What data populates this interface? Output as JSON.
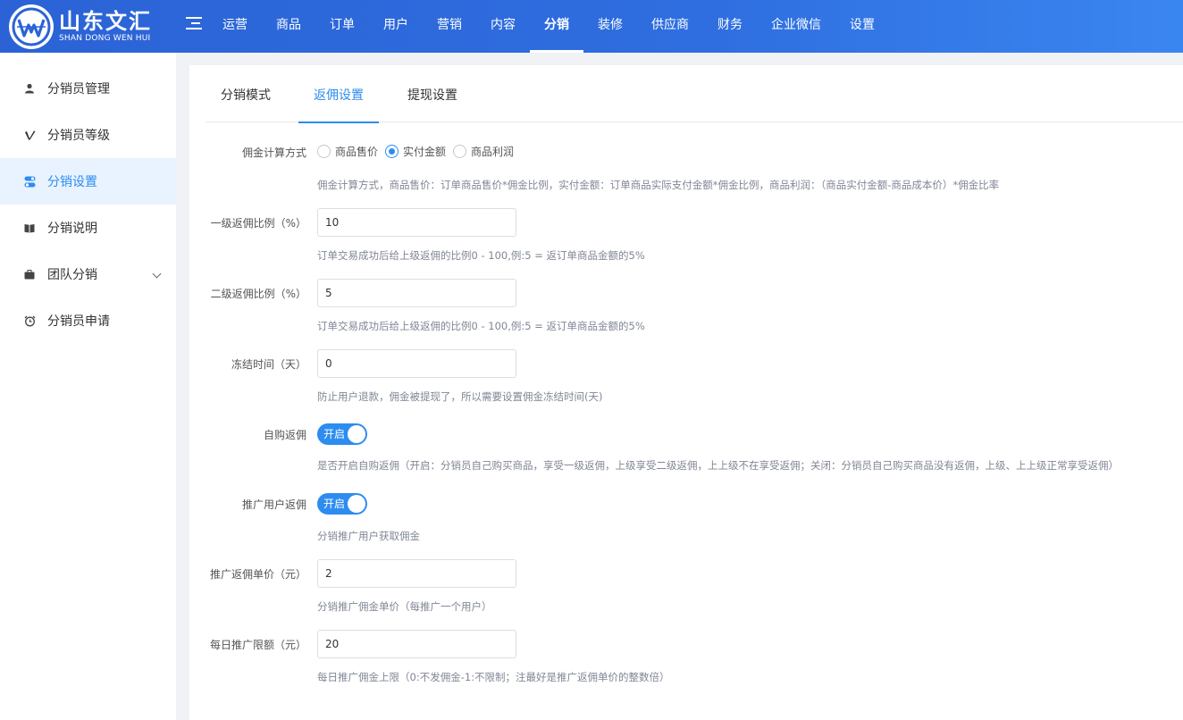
{
  "brand": {
    "name_cn": "山东文汇",
    "name_en": "SHAN DONG WEN HUI"
  },
  "topnav": {
    "items": [
      "运营",
      "商品",
      "订单",
      "用户",
      "营销",
      "内容",
      "分销",
      "装修",
      "供应商",
      "财务",
      "企业微信",
      "设置"
    ],
    "active": "分销"
  },
  "sidebar": {
    "items": [
      {
        "label": "分销员管理",
        "icon": "user-icon"
      },
      {
        "label": "分销员等级",
        "icon": "vimeo-v-icon"
      },
      {
        "label": "分销设置",
        "icon": "toggle-icon",
        "active": true
      },
      {
        "label": "分销说明",
        "icon": "book-icon"
      },
      {
        "label": "团队分销",
        "icon": "briefcase-icon",
        "expandable": true
      },
      {
        "label": "分销员申请",
        "icon": "alarm-clock-icon"
      }
    ]
  },
  "tabs": [
    "分销模式",
    "返佣设置",
    "提现设置"
  ],
  "active_tab": "返佣设置",
  "form": {
    "calc_method": {
      "label": "佣金计算方式",
      "options": [
        "商品售价",
        "实付金额",
        "商品利润"
      ],
      "selected": "实付金额",
      "hint": "佣金计算方式，商品售价：订单商品售价*佣金比例，实付金额：订单商品实际支付金额*佣金比例，商品利润：（商品实付金额-商品成本价）*佣金比率"
    },
    "level1_ratio": {
      "label": "一级返佣比例（%）",
      "value": "10",
      "hint": "订单交易成功后给上级返佣的比例0 - 100,例:5 = 返订单商品金额的5%"
    },
    "level2_ratio": {
      "label": "二级返佣比例（%）",
      "value": "5",
      "hint": "订单交易成功后给上级返佣的比例0 - 100,例:5 = 返订单商品金额的5%"
    },
    "freeze_days": {
      "label": "冻结时间（天）",
      "value": "0",
      "hint": "防止用户退款，佣金被提现了，所以需要设置佣金冻结时间(天)"
    },
    "self_purchase": {
      "label": "自购返佣",
      "state": "开启",
      "hint": "是否开启自购返佣（开启：分销员自己购买商品，享受一级返佣，上级享受二级返佣，上上级不在享受返佣；关闭：分销员自己购买商品没有返佣，上级、上上级正常享受返佣）"
    },
    "promote_user": {
      "label": "推广用户返佣",
      "state": "开启",
      "hint": "分销推广用户获取佣金"
    },
    "promote_price": {
      "label": "推广返佣单价（元）",
      "value": "2",
      "hint": "分销推广佣金单价（每推广一个用户）"
    },
    "daily_limit": {
      "label": "每日推广限额（元）",
      "value": "20",
      "hint": "每日推广佣金上限（0:不发佣金-1:不限制；注最好是推广返佣单价的整数倍）"
    }
  },
  "colors": {
    "primary": "#2d8cf0",
    "header": "#2f6ee0",
    "active_bg": "#e8f3ff"
  }
}
